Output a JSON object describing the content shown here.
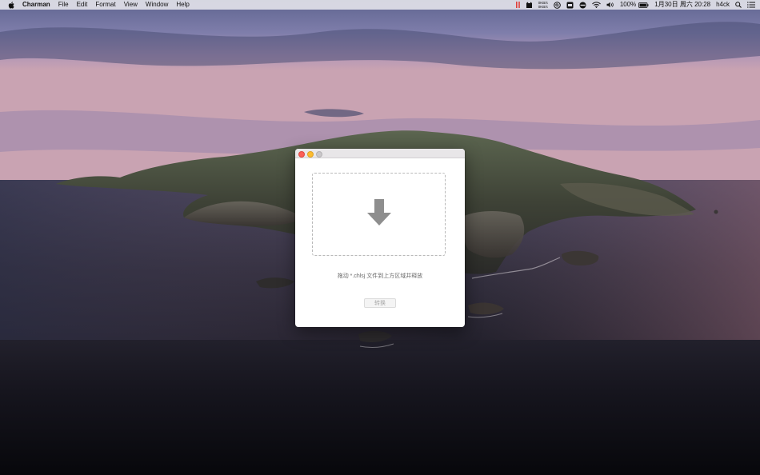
{
  "menubar": {
    "app_name": "Charman",
    "menus": [
      "File",
      "Edit",
      "Format",
      "View",
      "Window",
      "Help"
    ],
    "status": {
      "net_up": "0KB/s",
      "net_down": "0KB/s",
      "battery_percent": "100%",
      "datetime": "1月30日 周六 20:28",
      "username": "h4ck"
    },
    "icons": [
      "apple-icon",
      "pause-icon",
      "cat-icon",
      "search-bubble-icon",
      "box-icon",
      "vpn-icon",
      "wifi-icon",
      "volume-icon",
      "battery-icon",
      "spotlight-icon",
      "control-center-icon"
    ]
  },
  "window": {
    "dropzone_icon": "download-arrow-icon",
    "hint": "拖动 *.chlsj 文件到上方区域并释放",
    "convert_label": "转换",
    "convert_enabled": false
  },
  "colors": {
    "close": "#fc5f57",
    "minimize": "#fdbc2e",
    "zoom_disabled": "#c9c7c9",
    "arrow": "#8e8e8e"
  }
}
